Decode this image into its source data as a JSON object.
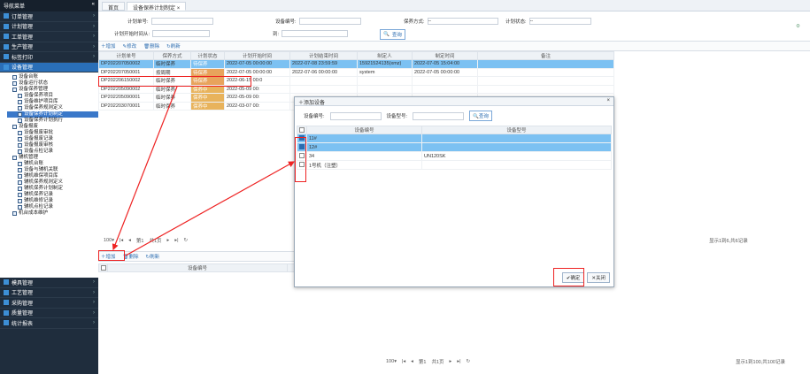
{
  "sidebar": {
    "title": "导航菜单",
    "collapse": "«",
    "items": [
      {
        "label": "订单管理"
      },
      {
        "label": "计划管理"
      },
      {
        "label": "工单管理"
      },
      {
        "label": "生产管理"
      },
      {
        "label": "标签打印"
      },
      {
        "label": "设备管理"
      }
    ],
    "tree": [
      "设备台账",
      "设备运行状态",
      "设备保养管理",
      "设备保养项目",
      "设备维护项目库",
      "设备保养规则定义",
      "设备保养计划制定",
      "设备保养计划执行",
      "设备报废",
      "设备报废审批",
      "设备报废记录",
      "设备报废审核",
      "设备点检记录",
      "辅机管理",
      "辅机台账",
      "设备与辅机关联",
      "辅机维保项目库",
      "辅机保养规则定义",
      "辅机保养计划制定",
      "辅机保养记录",
      "辅机维修记录",
      "辅机点检记录",
      "机台成本维护"
    ],
    "items_bottom": [
      {
        "label": "模具管理"
      },
      {
        "label": "工艺管理"
      },
      {
        "label": "采购管理"
      },
      {
        "label": "质量管理"
      },
      {
        "label": "统计报表"
      }
    ]
  },
  "tabs": [
    "首页",
    "设备保养计划制定"
  ],
  "filter": {
    "plan_no": "计划单号:",
    "device_no": "设备编号:",
    "maint_mode": "保养方式:",
    "plan_status": "计划状态:",
    "start_time": "计划开始时间从:",
    "to": "到:",
    "query": "查询",
    "sel": "--"
  },
  "toolbar": {
    "add": "增加",
    "edit": "修改",
    "delete": "删除",
    "refresh": "刷新"
  },
  "table": {
    "headers": [
      "计划单号",
      "保养方式",
      "计划状态",
      "计划开始时间",
      "计划结束时间",
      "制定人",
      "制定时间",
      "备注"
    ],
    "rows": [
      [
        "DP202207050002",
        "临时保养",
        "待保养",
        "2022-07-05 00:00:00",
        "2022-07-08 23:59:59",
        "15921524135(xmz)",
        "2022-07-05 15:04:00",
        ""
      ],
      [
        "DP202207050001",
        "按周期",
        "待保养",
        "2022-07-05 00:00:00",
        "2022-07-06 00:00:00",
        "system",
        "2022-07-05 00:00:00",
        ""
      ],
      [
        "DP202206150002",
        "临时保养",
        "待保养",
        "2022-06-15 00:0",
        "",
        "",
        "",
        ""
      ],
      [
        "DP202205090002",
        "临时保养",
        "保养中",
        "2022-05-09 00:",
        "",
        "",
        "",
        ""
      ],
      [
        "DP202205090001",
        "临时保养",
        "保养中",
        "2022-05-09 00:",
        "",
        "",
        "",
        ""
      ],
      [
        "DP202203070001",
        "临时保养",
        "保养中",
        "2022-03-07 00:",
        "",
        "",
        "",
        ""
      ]
    ]
  },
  "pager1": {
    "size": "100",
    "page_label": "第1",
    "total_label": "共1页",
    "info": "显示1到6,共6记录"
  },
  "toolbar2": {
    "add": "增加",
    "delete": "删除",
    "refresh": "刷新"
  },
  "detail": {
    "headers": [
      "设备编号",
      "设备"
    ]
  },
  "pager2": {
    "size": "100",
    "page": "第1",
    "total": "共1页",
    "info": "显示1到100,共100记录"
  },
  "dialog": {
    "title": "添加设备",
    "close": "×",
    "dev_no": "设备编号:",
    "dev_model": "设备型号:",
    "query": "查询",
    "headers": [
      "设备编号",
      "设备型号"
    ],
    "rows": [
      {
        "no": "11#",
        "model": "",
        "checked": true
      },
      {
        "no": "12#",
        "model": "",
        "checked": true
      },
      {
        "no": "34",
        "model": "UN120SK",
        "checked": false
      },
      {
        "no": "1号机（注塑）",
        "model": "",
        "checked": false
      }
    ],
    "ok": "确定",
    "cancel": "关闭"
  }
}
